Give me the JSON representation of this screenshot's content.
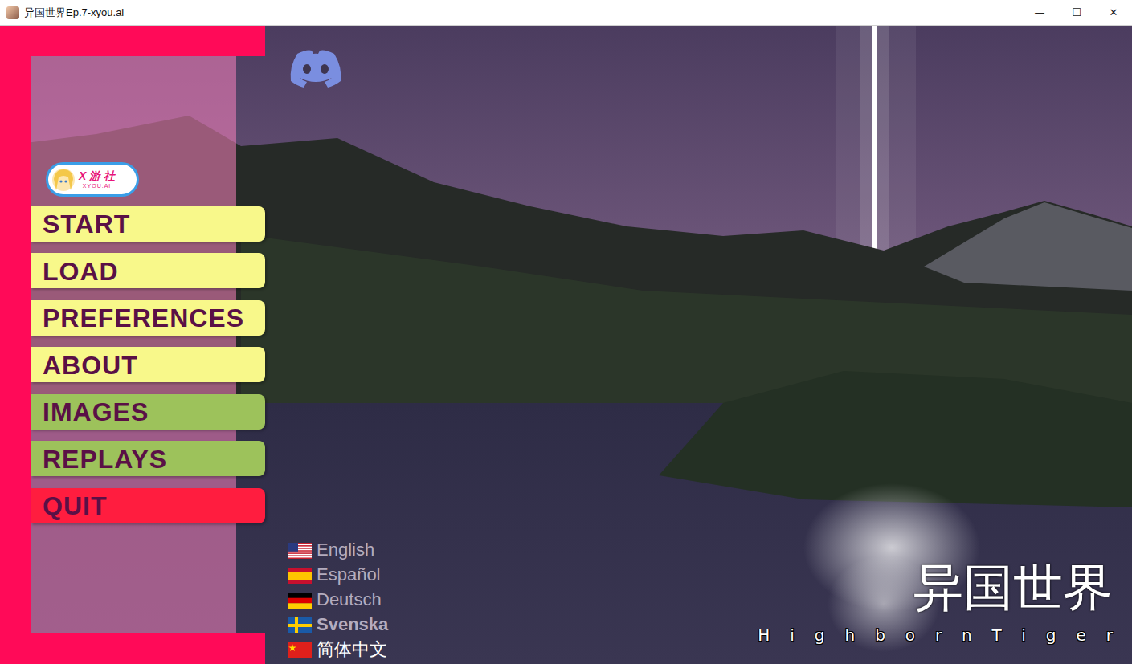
{
  "window": {
    "title": "异国世界Ep.7-xyou.ai",
    "controls": [
      "—",
      "☐",
      "✕"
    ]
  },
  "badge": {
    "brand": "X 游 社",
    "domain": "XYOU.AI"
  },
  "menu": [
    {
      "label": "START",
      "color": "#f8f88a"
    },
    {
      "label": "LOAD",
      "color": "#f8f88a"
    },
    {
      "label": "PREFERENCES",
      "color": "#f8f88a"
    },
    {
      "label": "ABOUT",
      "color": "#f8f88a"
    },
    {
      "label": "IMAGES",
      "color": "#9dc25b"
    },
    {
      "label": "REPLAYS",
      "color": "#9dc25b"
    },
    {
      "label": "QUIT",
      "color": "#ff1d3f"
    }
  ],
  "languages": [
    {
      "label": "English",
      "kind": "us",
      "selected": false,
      "hovered": false
    },
    {
      "label": "Español",
      "kind": "es",
      "selected": false,
      "hovered": false
    },
    {
      "label": "Deutsch",
      "kind": "de",
      "selected": false,
      "hovered": false
    },
    {
      "label": "Svenska",
      "kind": "se",
      "selected": false,
      "hovered": true
    },
    {
      "label": "简体中文",
      "kind": "cn",
      "selected": true,
      "hovered": false
    }
  ],
  "game_title": "异国世界",
  "studio": "HighbornTiger"
}
